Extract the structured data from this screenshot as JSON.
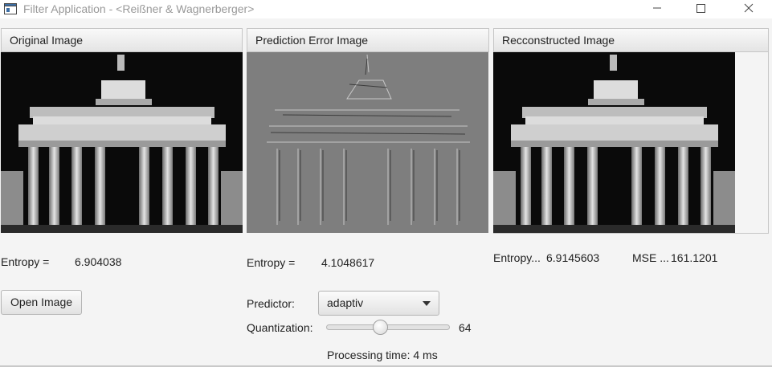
{
  "window": {
    "title": "Filter Application - <Reißner & Wagnerberger>"
  },
  "panels": [
    {
      "header": "Original Image",
      "image": "brandenburg-gate-original"
    },
    {
      "header": "Prediction Error Image",
      "image": "prediction-error"
    },
    {
      "header": "Recconstructed Image",
      "image": "brandenburg-gate-reconstructed"
    }
  ],
  "stats": {
    "original_entropy_label": "Entropy =",
    "original_entropy_value": "6.904038",
    "error_entropy_label": "Entropy =",
    "error_entropy_value": "4.1048617",
    "recon_entropy_label": "Entropy...",
    "recon_entropy_value": "6.9145603",
    "mse_label": "MSE ...",
    "mse_value": "161.1201"
  },
  "controls": {
    "open_button": "Open Image",
    "predictor_label": "Predictor:",
    "predictor_value": "adaptiv",
    "quantization_label": "Quantization:",
    "quantization_value": "64",
    "quantization_fraction": 0.44,
    "processing_time": "Processing time: 4 ms"
  },
  "icons": {
    "app": "app-window-icon",
    "minimize": "minimize-icon",
    "maximize": "maximize-icon",
    "close": "close-icon",
    "dropdown": "chevron-down-icon"
  }
}
